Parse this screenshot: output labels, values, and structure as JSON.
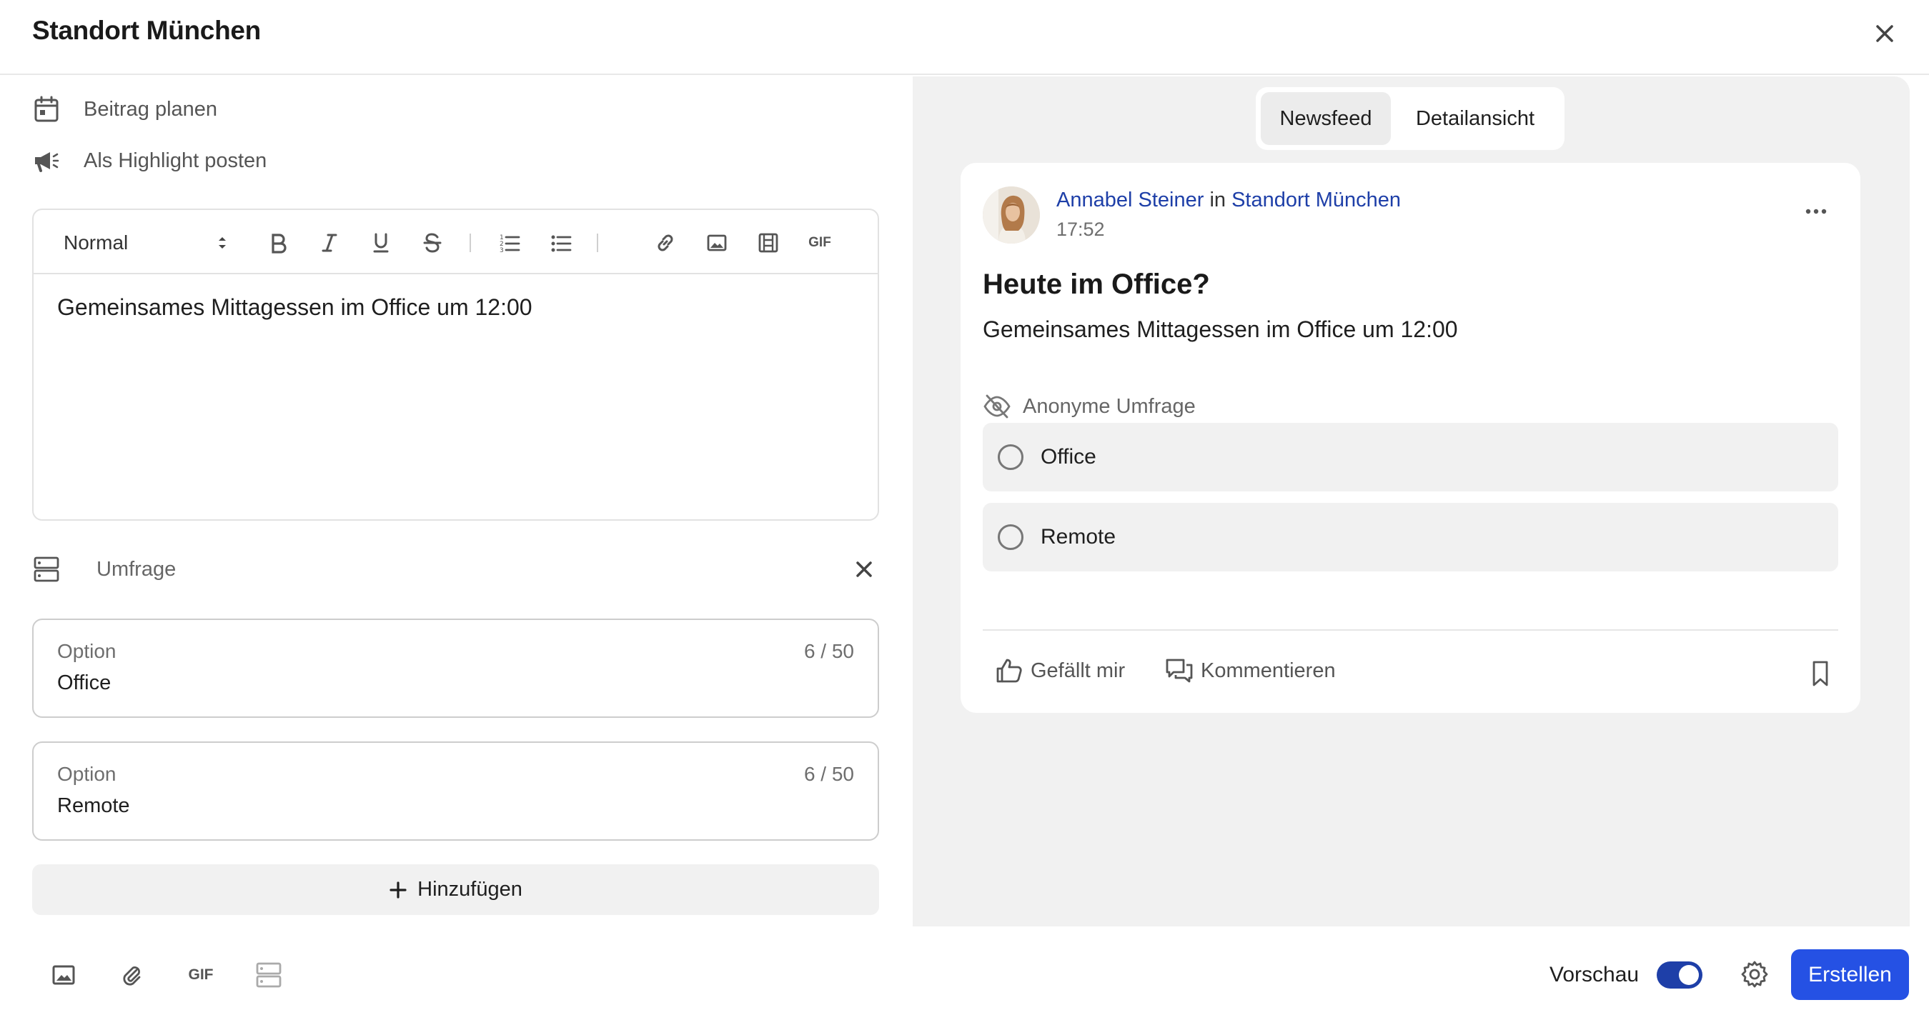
{
  "header": {
    "title": "Standort München"
  },
  "left": {
    "schedule_label": "Beitrag planen",
    "highlight_label": "Als Highlight posten",
    "editor": {
      "format_select": "Normal",
      "gif_label": "GIF",
      "content": "Gemeinsames Mittagessen im Office um 12:00"
    },
    "poll": {
      "label": "Umfrage",
      "options": [
        {
          "label": "Option",
          "value": "Office",
          "count": "6 / 50"
        },
        {
          "label": "Option",
          "value": "Remote",
          "count": "6 / 50"
        }
      ],
      "add_label": "Hinzufügen"
    }
  },
  "bottom": {
    "gif_label": "GIF",
    "preview_label": "Vorschau",
    "preview_enabled": true,
    "create_label": "Erstellen"
  },
  "preview": {
    "tabs": [
      {
        "label": "Newsfeed",
        "active": true
      },
      {
        "label": "Detailansicht",
        "active": false
      }
    ],
    "post": {
      "author": "Annabel Steiner",
      "in_word": "in",
      "group": "Standort München",
      "time": "17:52",
      "title": "Heute im Office?",
      "body": "Gemeinsames Mittagessen im Office um 12:00",
      "poll_type": "Anonyme Umfrage",
      "poll_options": [
        "Office",
        "Remote"
      ],
      "like_label": "Gefällt mir",
      "comment_label": "Kommentieren"
    }
  },
  "colors": {
    "accent": "#2551e4",
    "link": "#1e3fa8",
    "preview_bg": "#f1f1f1"
  }
}
